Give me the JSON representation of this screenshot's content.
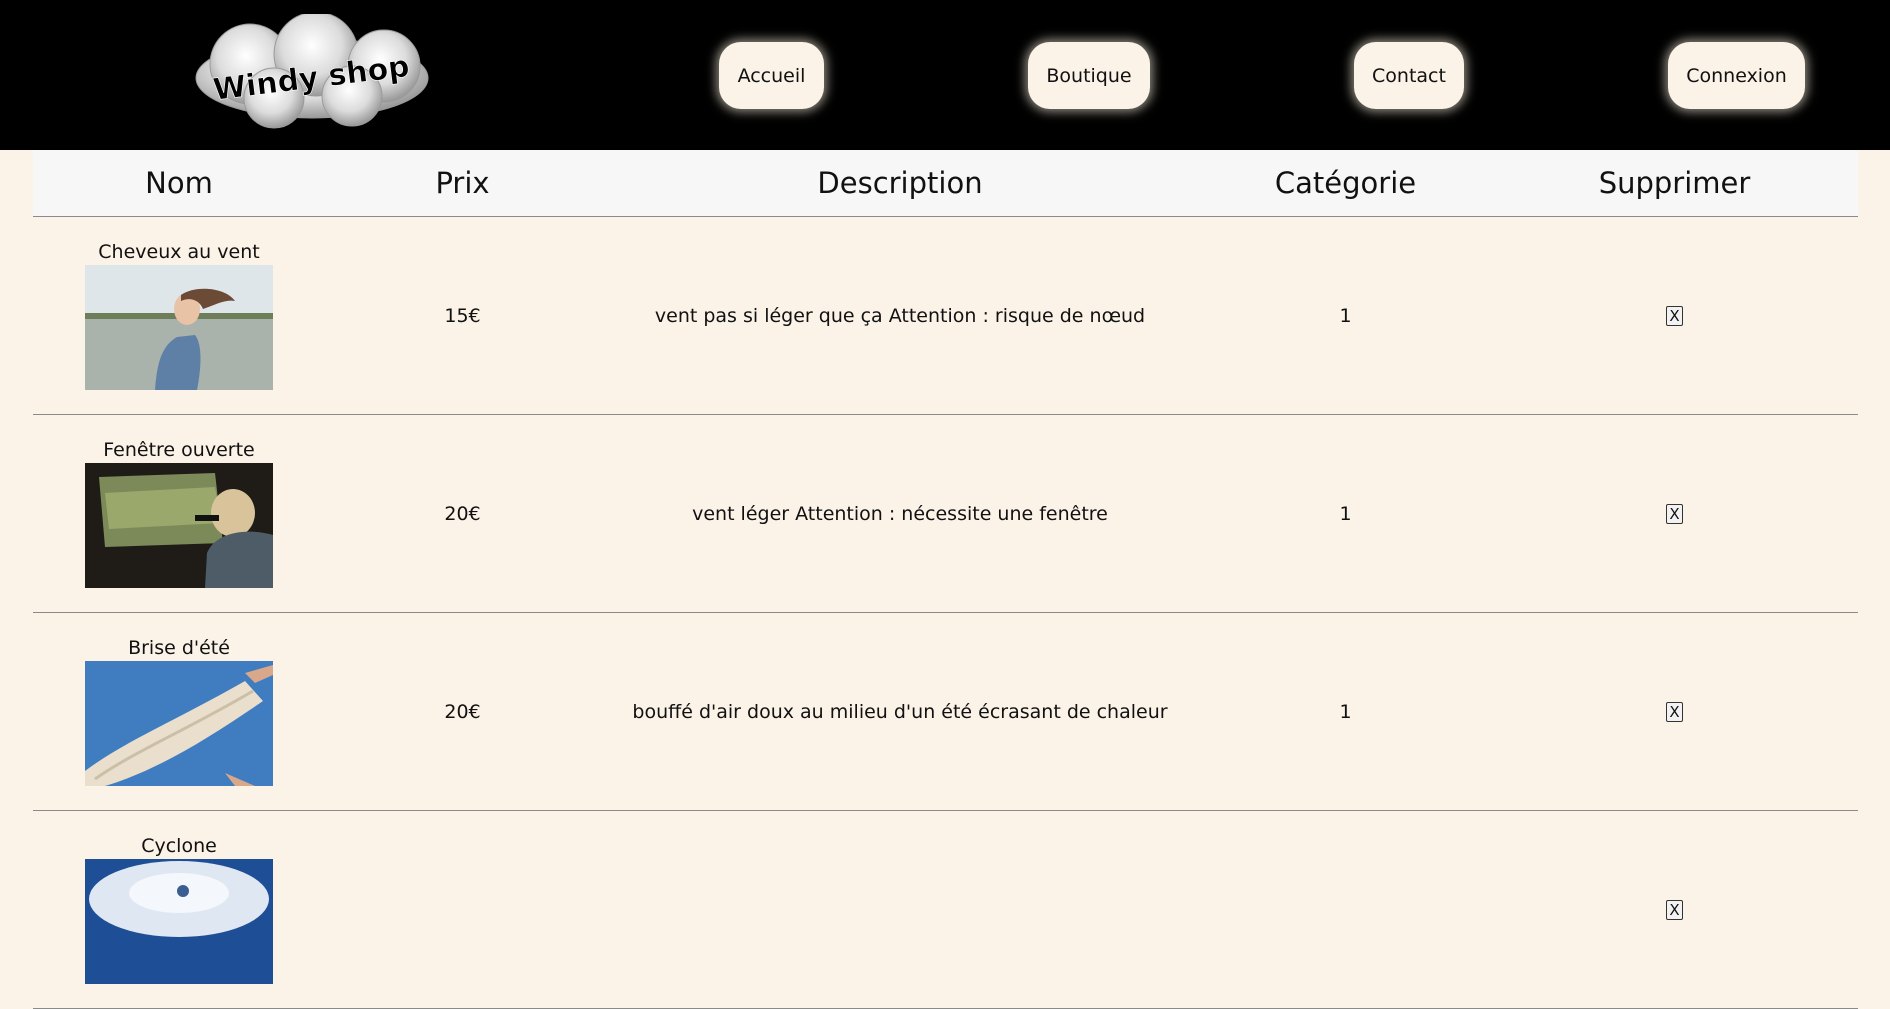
{
  "header": {
    "logo_text": "Windy shop",
    "nav": [
      {
        "label": "Accueil"
      },
      {
        "label": "Boutique"
      },
      {
        "label": "Contact"
      },
      {
        "label": "Connexion"
      }
    ]
  },
  "table": {
    "columns": [
      "Nom",
      "Prix",
      "Description",
      "Catégorie",
      "Supprimer"
    ],
    "rows": [
      {
        "name": "Cheveux au vent",
        "price": "15€",
        "description": "vent pas si léger que ça Attention : risque de nœud",
        "category": "1",
        "delete": "X",
        "image": "woman-hair-in-wind-photo"
      },
      {
        "name": "Fenêtre ouverte",
        "price": "20€",
        "description": "vent léger Attention : nécessite une fenêtre",
        "category": "1",
        "delete": "X",
        "image": "car-window-photo"
      },
      {
        "name": "Brise d'été",
        "price": "20€",
        "description": "bouffé d'air doux au milieu d'un été écrasant de chaleur",
        "category": "1",
        "delete": "X",
        "image": "scarf-in-sky-photo"
      },
      {
        "name": "Cyclone",
        "price": "",
        "description": "",
        "category": "",
        "delete": "X",
        "image": "cyclone-satellite-photo"
      }
    ]
  },
  "colors": {
    "header_bg": "#000000",
    "page_bg": "#fbf2e8",
    "table_head_bg": "#f7f7f7"
  }
}
